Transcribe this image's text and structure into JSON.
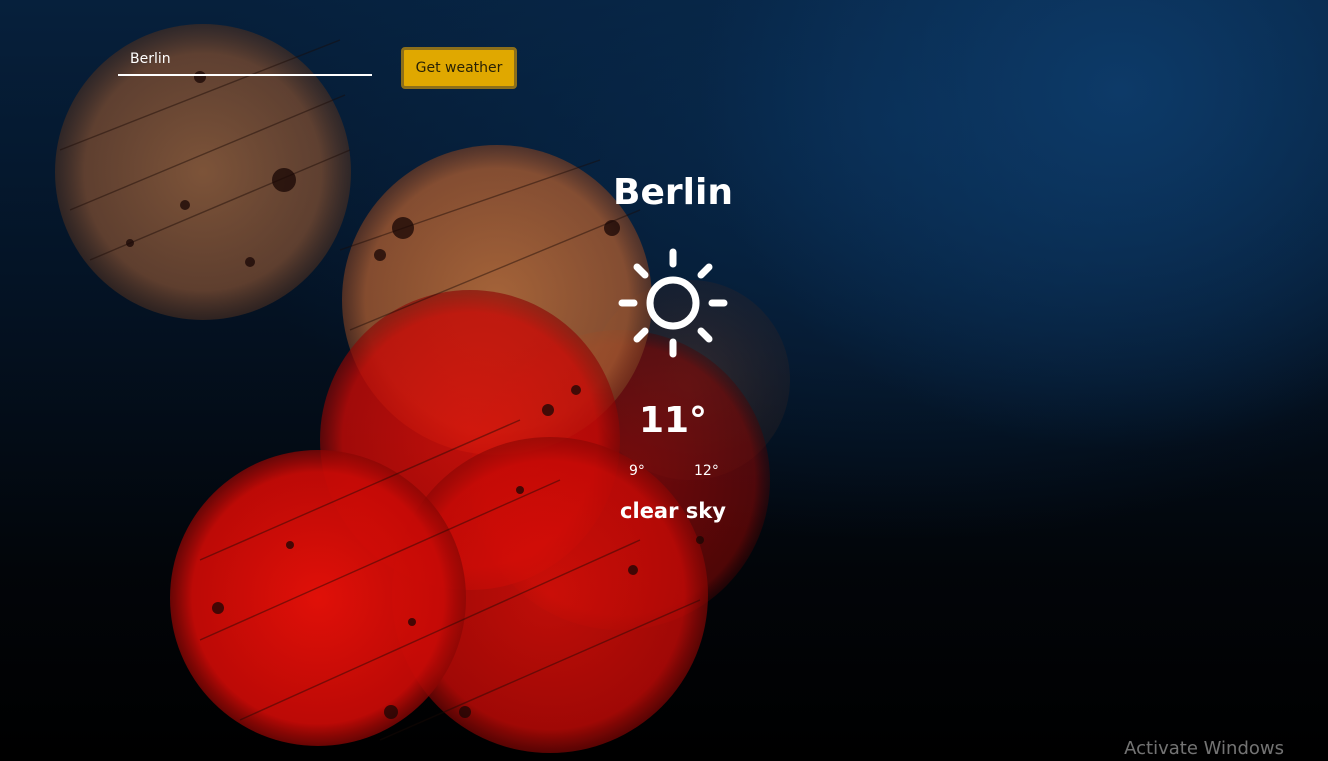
{
  "search": {
    "value": "Berlin"
  },
  "button": {
    "label": "Get weather",
    "color": "#e0a800"
  },
  "weather": {
    "city": "Berlin",
    "icon": "sun-icon",
    "temperature": "11°",
    "min": "9°",
    "max": "12°",
    "description": "clear sky"
  },
  "watermark": {
    "text": "Activate Windows"
  }
}
